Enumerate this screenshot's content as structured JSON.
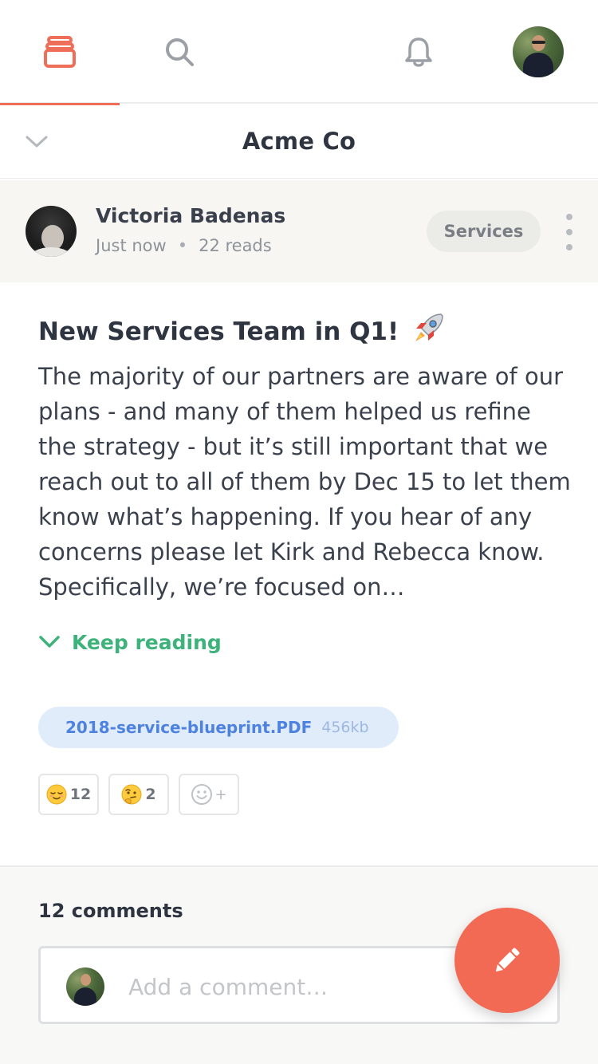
{
  "nav": {
    "feed_icon": "stack-icon",
    "search_icon": "search-icon",
    "notifications_icon": "bell-icon",
    "profile_icon": "avatar",
    "accent_color": "#ee6e57"
  },
  "workspace": {
    "name": "Acme Co",
    "toggle_icon": "chevron-down-icon"
  },
  "post": {
    "author": {
      "name": "Victoria Badenas",
      "time": "Just now",
      "separator": "•",
      "reads": "22 reads"
    },
    "tag": "Services",
    "more_icon": "more-vertical-icon",
    "title": "New Services Team in Q1!",
    "title_emoji": "rocket-icon",
    "body": "The majority of our partners are aware of our plans - and many of them helped us refine the strategy - but it’s still important that we reach out to all of them by Dec 15 to let them know what’s happening. If you hear of any concerns please let Kirk and Rebecca know. Specifically, we’re focused on…",
    "keep_reading": "Keep reading",
    "attachment": {
      "name": "2018-service-blueprint.PDF",
      "size": "456kb"
    },
    "reactions": [
      {
        "emoji": "relieved-face-icon",
        "count": "12"
      },
      {
        "emoji": "thinking-face-icon",
        "count": "2"
      },
      {
        "emoji": "add-reaction-icon",
        "count": "+"
      }
    ]
  },
  "comments": {
    "count_label": "12 comments",
    "placeholder": "Add a comment…",
    "fab_icon": "pencil-icon",
    "fab_color": "#f26a54"
  }
}
